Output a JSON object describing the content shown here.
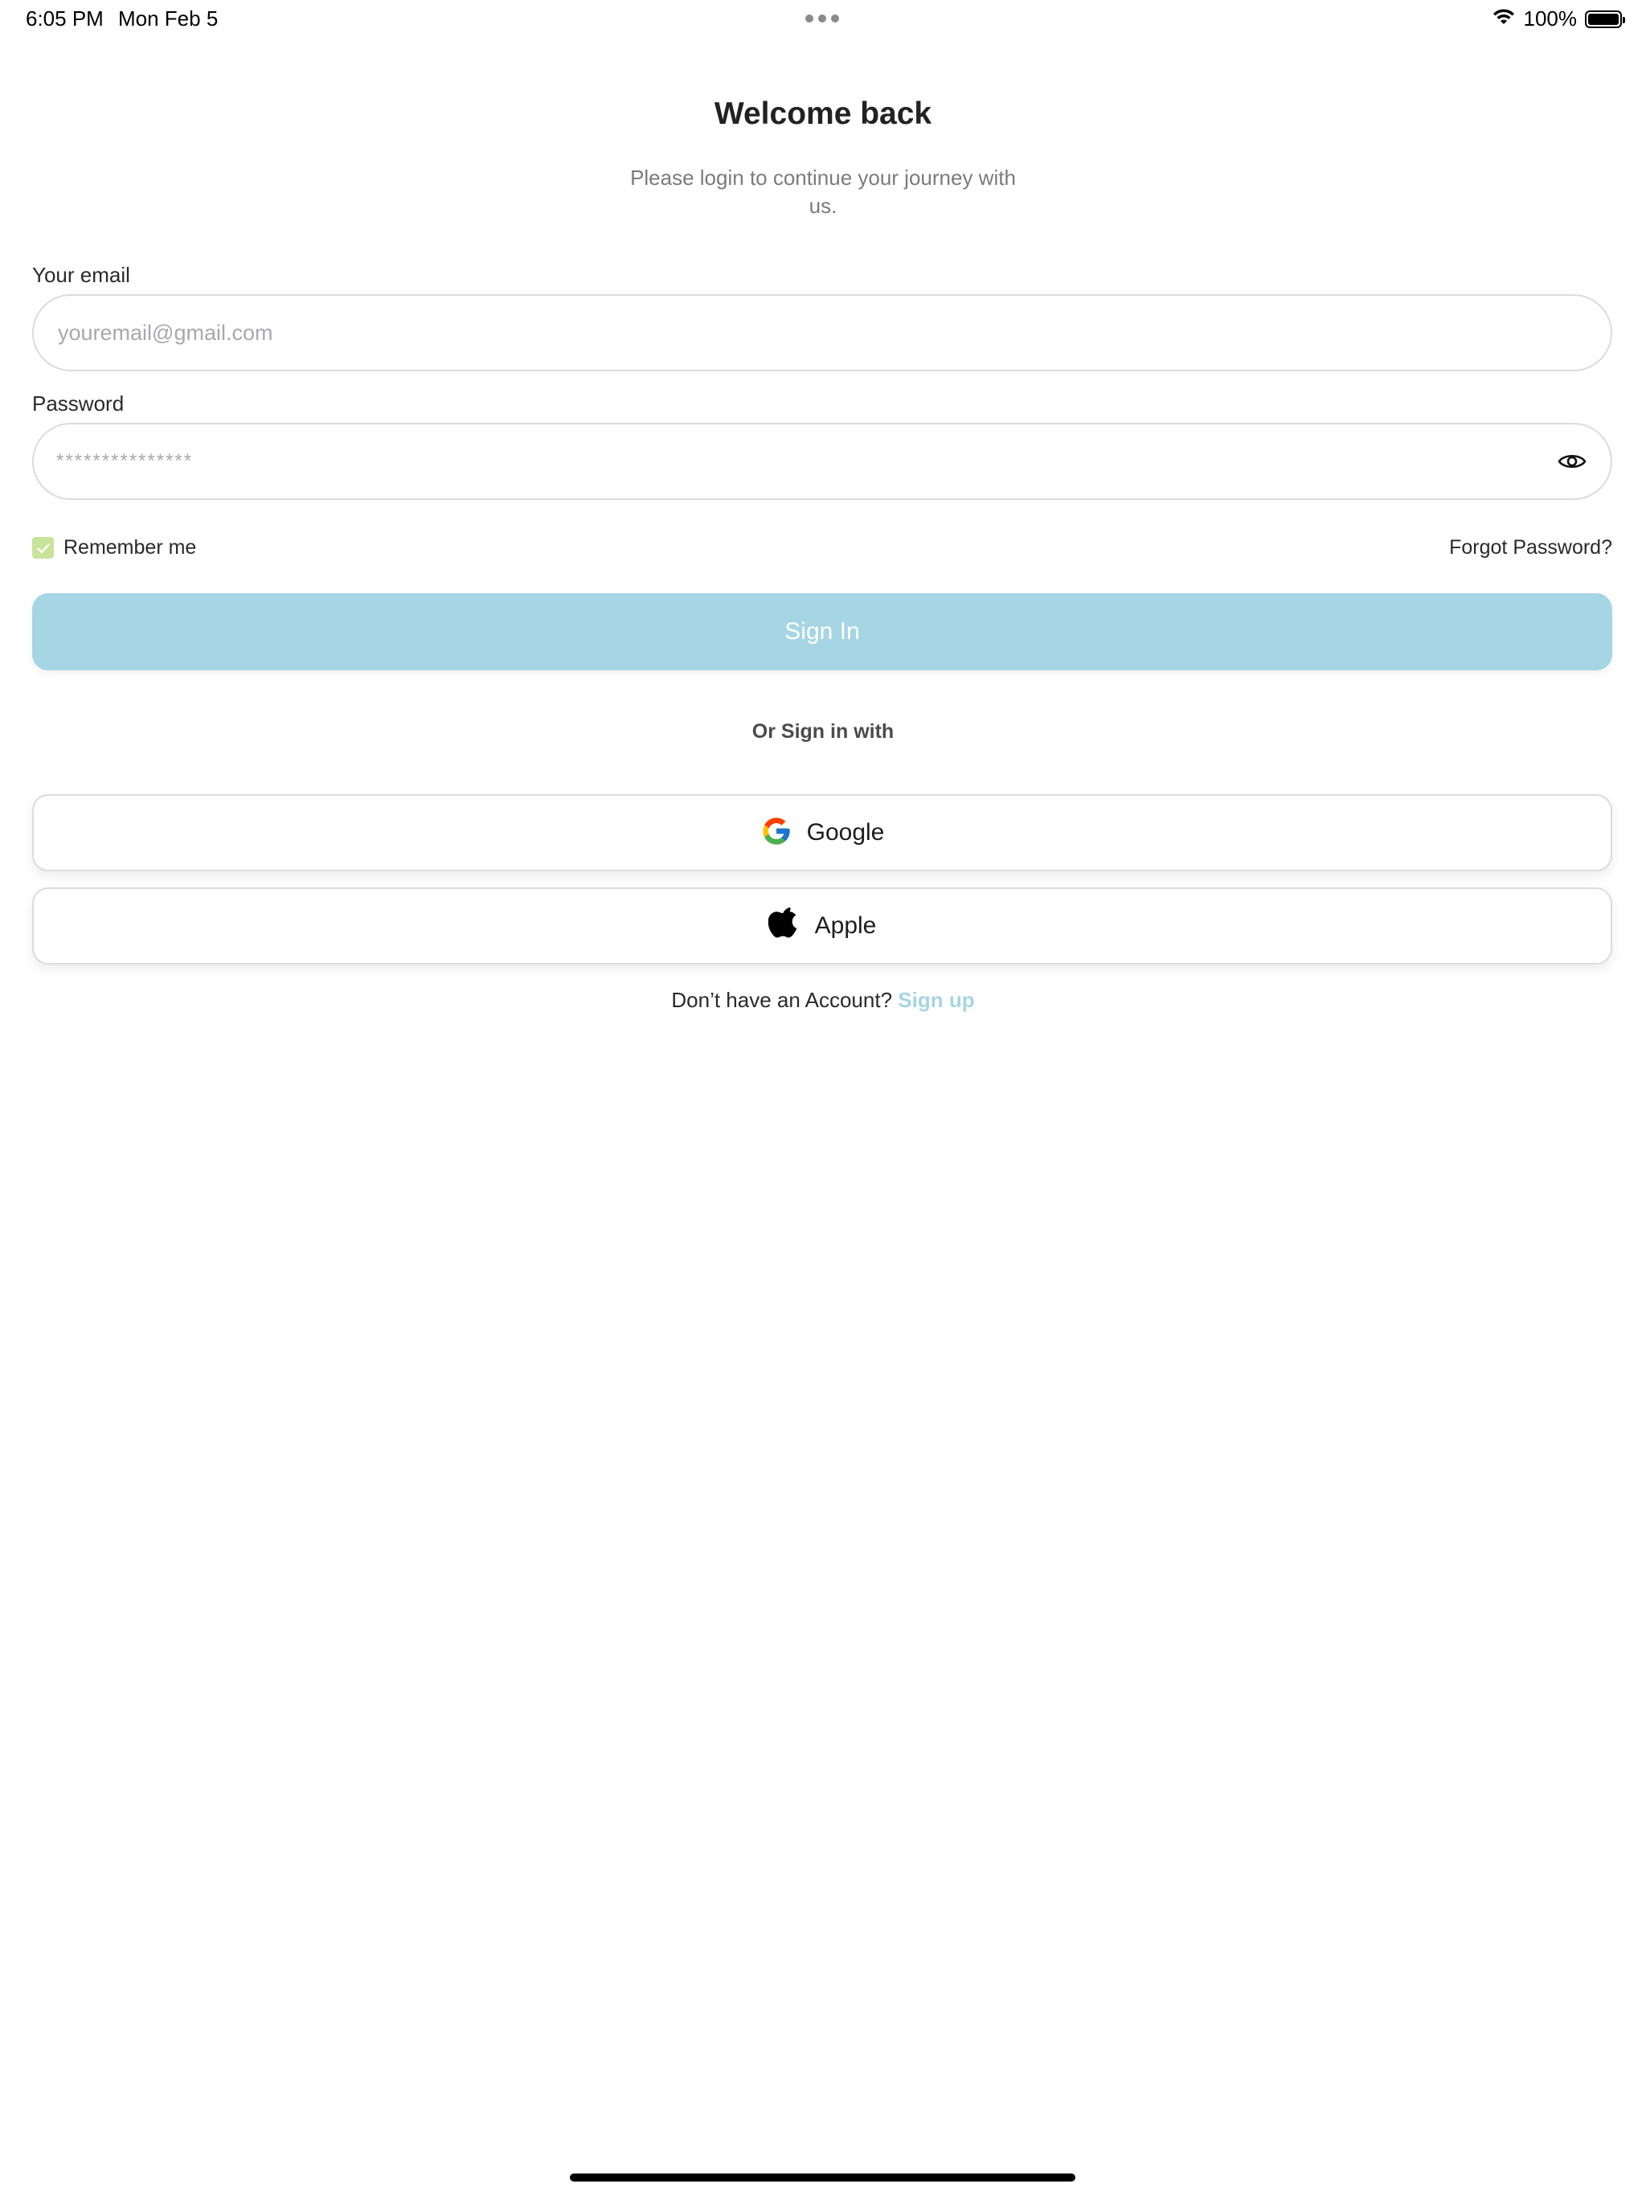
{
  "status_bar": {
    "time": "6:05 PM",
    "date": "Mon Feb 5",
    "battery_percent": "100%"
  },
  "header": {
    "title": "Welcome back",
    "subtitle": "Please login to continue your journey with us."
  },
  "form": {
    "email_label": "Your email",
    "email_placeholder": "youremail@gmail.com",
    "password_label": "Password",
    "password_mask": "***************",
    "remember_label": "Remember me",
    "remember_checked": true,
    "forgot_label": "Forgot Password?",
    "signin_label": "Sign In"
  },
  "social": {
    "divider": "Or Sign in with",
    "google_label": "Google",
    "apple_label": "Apple"
  },
  "footer": {
    "prompt": "Don’t have an Account?",
    "signup_label": "Sign up"
  },
  "colors": {
    "accent": "#a6d5e3",
    "checkbox": "#c8e39a"
  }
}
